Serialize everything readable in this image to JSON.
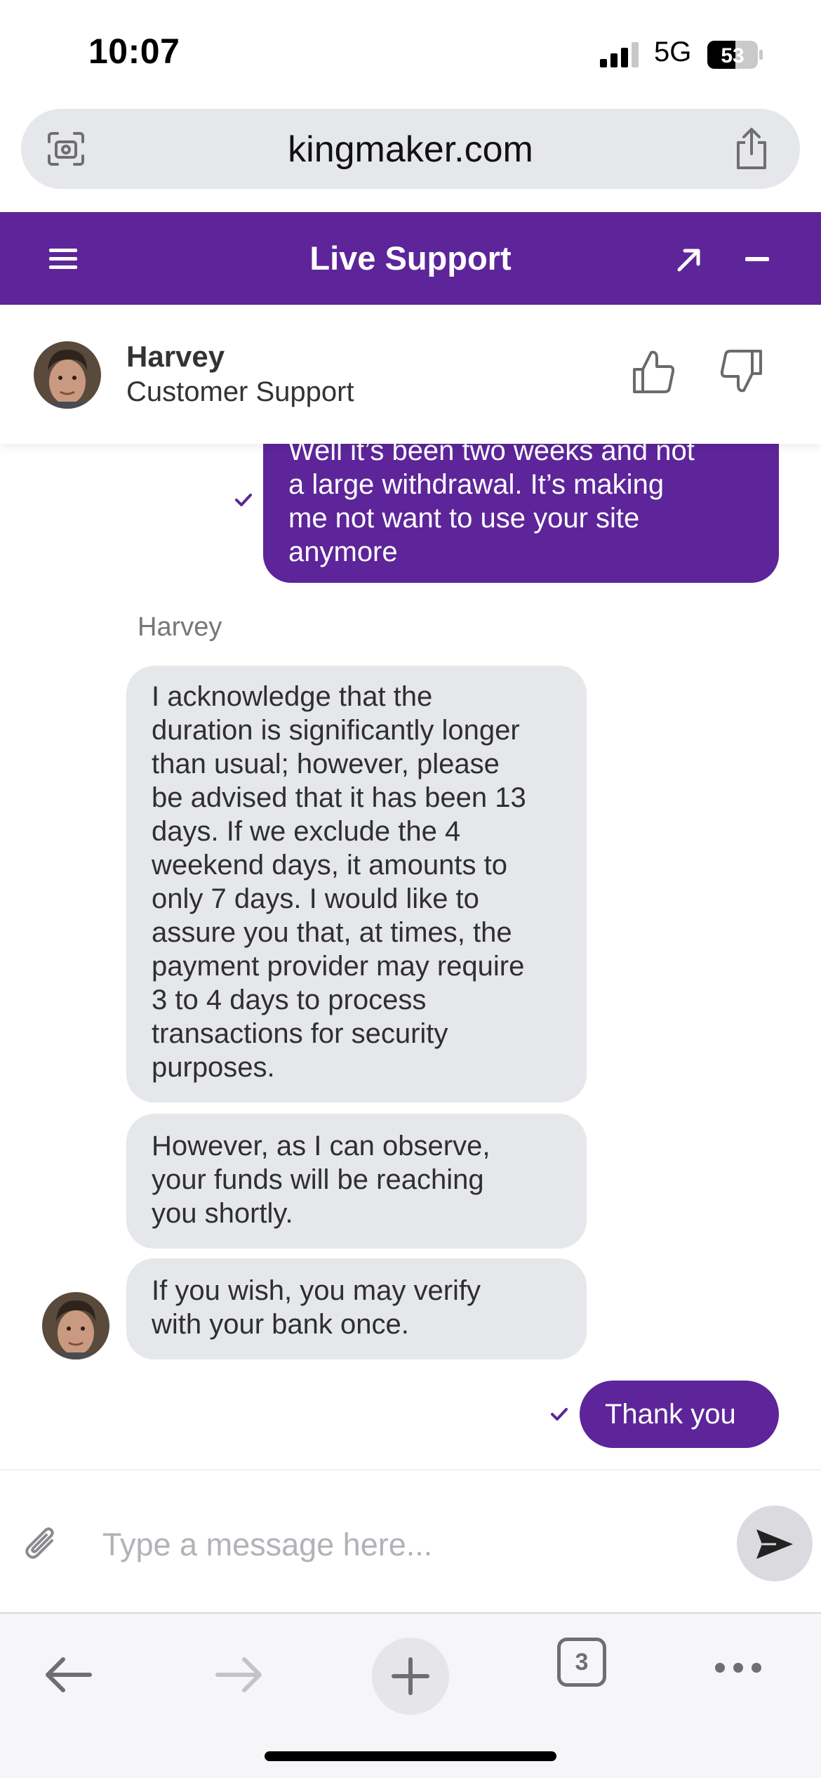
{
  "status_bar": {
    "time": "10:07",
    "network": "5G",
    "battery": "53"
  },
  "browser": {
    "url": "kingmaker.com",
    "open_tabs": "3"
  },
  "chat": {
    "title": "Live Support",
    "agent": {
      "name": "Harvey",
      "role": "Customer Support"
    },
    "messages": [
      {
        "from": "user",
        "lines": [
          "Well it’s been two weeks and not",
          "a large withdrawal.  It’s making",
          "me not want to use your site",
          "anymore"
        ]
      },
      {
        "from": "agent",
        "sender": "Harvey",
        "lines": [
          "I acknowledge that the",
          "duration is significantly longer",
          "than usual; however, please",
          "be advised that it has been 13",
          "days. If we exclude the 4",
          "weekend days, it amounts to",
          "only 7 days. I would like to",
          "assure you that, at times, the",
          "payment provider may require",
          "3 to 4 days to process",
          "transactions for security",
          "purposes."
        ]
      },
      {
        "from": "agent",
        "lines": [
          "However, as I can observe,",
          "your funds will be reaching",
          "you shortly."
        ]
      },
      {
        "from": "agent",
        "lines": [
          "If you wish, you may verify",
          "with your bank once."
        ]
      },
      {
        "from": "user",
        "lines": [
          "Thank you"
        ]
      }
    ],
    "composer": {
      "placeholder": "Type a message here..."
    }
  },
  "colors": {
    "brand_purple": "#5d2599",
    "agent_bubble": "#e6e7eb"
  },
  "icons": [
    "camera-search-icon",
    "share-icon",
    "menu-icon",
    "expand-icon",
    "minimize-icon",
    "thumbs-up-icon",
    "thumbs-down-icon",
    "check-icon",
    "paperclip-icon",
    "send-icon",
    "back-arrow-icon",
    "forward-arrow-icon",
    "plus-icon",
    "more-icon"
  ]
}
